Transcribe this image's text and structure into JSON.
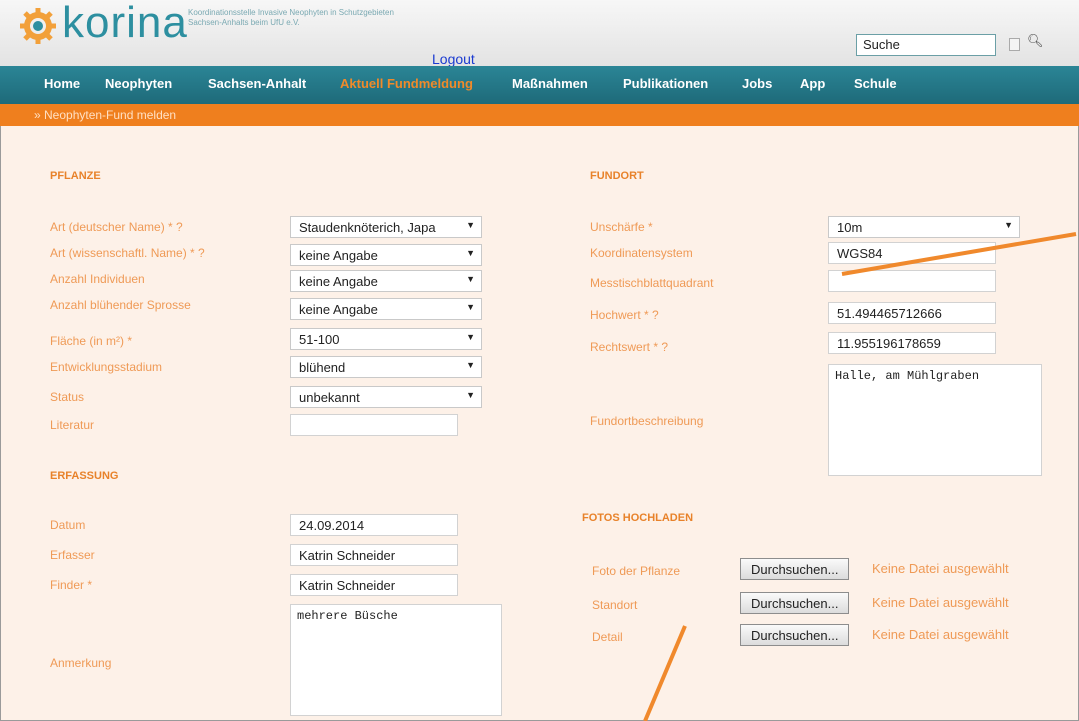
{
  "header": {
    "logo_text": "korina",
    "logo_subtitle": "Koordinationsstelle Invasive Neophyten in Schutzgebieten Sachsen-Anhalts beim UfU e.V.",
    "logout": "Logout",
    "search_value": "Suche"
  },
  "nav": {
    "items": [
      "Home",
      "Neophyten",
      "Sachsen-Anhalt",
      "Aktuell Fundmeldung",
      "Maßnahmen",
      "Publikationen",
      "Jobs",
      "App",
      "Schule"
    ]
  },
  "subnav": {
    "label": "» Neophyten-Fund melden"
  },
  "pflanze": {
    "title": "PFLANZE",
    "fields": [
      {
        "label": "Art (deutscher Name) *  ?",
        "value": "Staudenknöterich, Japa"
      },
      {
        "label": "Art (wissenschaftl. Name) *  ?",
        "value": "keine Angabe"
      },
      {
        "label": "Anzahl Individuen",
        "value": "keine Angabe"
      },
      {
        "label": "Anzahl blühender Sprosse",
        "value": "keine Angabe"
      },
      {
        "label": "Fläche (in m²) *",
        "value": "51-100"
      },
      {
        "label": "Entwicklungsstadium",
        "value": "blühend"
      },
      {
        "label": "Status",
        "value": "unbekannt"
      }
    ],
    "literatur_label": "Literatur",
    "literatur_value": ""
  },
  "erfassung": {
    "title": "ERFASSUNG",
    "datum_label": "Datum",
    "datum_value": "24.09.2014",
    "erfasser_label": "Erfasser",
    "erfasser_value": "Katrin Schneider",
    "finder_label": "Finder *",
    "finder_value": "Katrin Schneider",
    "anmerkung_label": "Anmerkung",
    "anmerkung_value": "mehrere Büsche"
  },
  "fundort": {
    "title": "FUNDORT",
    "unschaerfe_label": "Unschärfe *",
    "unschaerfe_value": "10m",
    "koordsys_label": "Koordinatensystem",
    "koordsys_value": "WGS84",
    "mtb_label": "Messtischblattquadrant",
    "mtb_value": "",
    "hochwert_label": "Hochwert *  ?",
    "hochwert_value": "51.494465712666",
    "rechtswert_label": "Rechtswert *  ?",
    "rechtswert_value": "11.955196178659",
    "beschreibung_label": "Fundortbeschreibung",
    "beschreibung_value": "Halle, am Mühlgraben"
  },
  "fotos": {
    "title": "FOTOS HOCHLADEN",
    "rows": [
      {
        "label": "Foto der Pflanze",
        "button": "Durchsuchen...",
        "status": "Keine Datei ausgewählt"
      },
      {
        "label": "Standort",
        "button": "Durchsuchen...",
        "status": "Keine Datei ausgewählt"
      },
      {
        "label": "Detail",
        "button": "Durchsuchen...",
        "status": "Keine Datei ausgewählt"
      }
    ]
  },
  "colors": {
    "accent": "#ef7f1e",
    "nav": "#22788a",
    "background": "#fdf1e8"
  }
}
